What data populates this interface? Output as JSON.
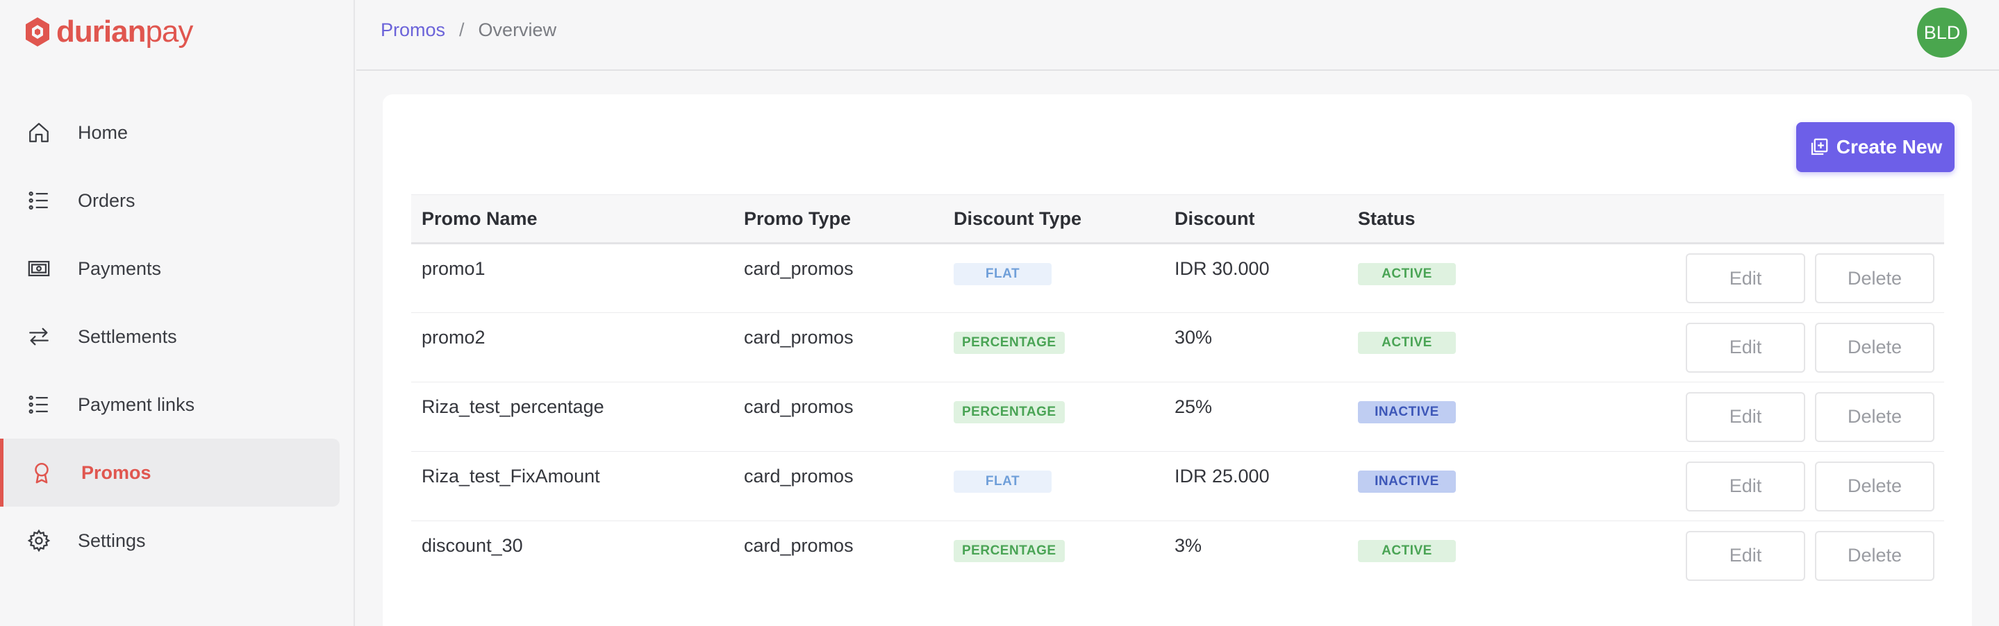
{
  "brand": {
    "name_bold": "durian",
    "name_light": "pay",
    "color": "#e0564f"
  },
  "sidebar": {
    "items": [
      {
        "label": "Home",
        "icon": "home-icon",
        "active": false
      },
      {
        "label": "Orders",
        "icon": "list-icon",
        "active": false
      },
      {
        "label": "Payments",
        "icon": "payments-icon",
        "active": false
      },
      {
        "label": "Settlements",
        "icon": "transfer-arrows-icon",
        "active": false
      },
      {
        "label": "Payment links",
        "icon": "list-icon",
        "active": false
      },
      {
        "label": "Promos",
        "icon": "award-icon",
        "active": true
      },
      {
        "label": "Settings",
        "icon": "gear-icon",
        "active": false
      }
    ]
  },
  "header": {
    "breadcrumb": {
      "parent": "Promos",
      "separator": "/",
      "current": "Overview"
    },
    "avatar_initials": "BLD",
    "avatar_color": "#4aa64e"
  },
  "toolbar": {
    "create_label": "Create New",
    "accent": "#6d5fe8"
  },
  "table": {
    "columns": [
      "Promo Name",
      "Promo Type",
      "Discount Type",
      "Discount",
      "Status"
    ],
    "rows": [
      {
        "name": "promo1",
        "type": "card_promos",
        "discount_type": "FLAT",
        "discount": "IDR 30.000",
        "status": "ACTIVE",
        "edit": "Edit",
        "delete": "Delete"
      },
      {
        "name": "promo2",
        "type": "card_promos",
        "discount_type": "PERCENTAGE",
        "discount": "30%",
        "status": "ACTIVE",
        "edit": "Edit",
        "delete": "Delete"
      },
      {
        "name": "Riza_test_percentage",
        "type": "card_promos",
        "discount_type": "PERCENTAGE",
        "discount": "25%",
        "status": "INACTIVE",
        "edit": "Edit",
        "delete": "Delete"
      },
      {
        "name": "Riza_test_FixAmount",
        "type": "card_promos",
        "discount_type": "FLAT",
        "discount": "IDR 25.000",
        "status": "INACTIVE",
        "edit": "Edit",
        "delete": "Delete"
      },
      {
        "name": "discount_30",
        "type": "card_promos",
        "discount_type": "PERCENTAGE",
        "discount": "3%",
        "status": "ACTIVE",
        "edit": "Edit",
        "delete": "Delete"
      }
    ]
  }
}
